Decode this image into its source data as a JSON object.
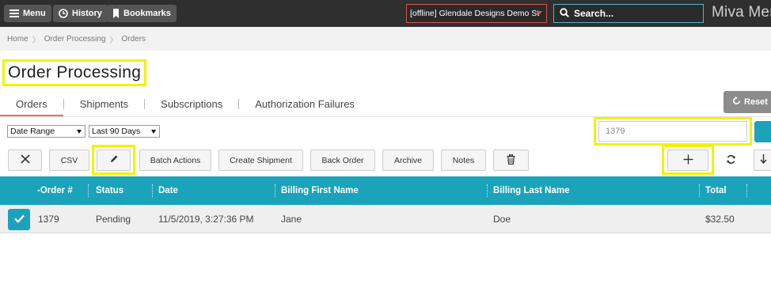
{
  "topbar": {
    "menu_label": "Menu",
    "history_label": "History",
    "bookmarks_label": "Bookmarks",
    "store_select_value": "[offline] Glendale Designs Demo St",
    "search_placeholder": "Search...",
    "brand": "Miva Mer"
  },
  "breadcrumb": [
    "Home",
    "Order Processing",
    "Orders"
  ],
  "page": {
    "title": "Order Processing"
  },
  "tabs": [
    {
      "label": "Orders",
      "active": true
    },
    {
      "label": "Shipments",
      "active": false
    },
    {
      "label": "Subscriptions",
      "active": false
    },
    {
      "label": "Authorization Failures",
      "active": false
    }
  ],
  "reset_label": "Reset",
  "filters": {
    "field_select": "Date Range",
    "range_select": "Last 90 Days",
    "search_value": "1379"
  },
  "toolbar": {
    "csv_label": "CSV",
    "batch_label": "Batch Actions",
    "create_shipment_label": "Create Shipment",
    "back_order_label": "Back Order",
    "archive_label": "Archive",
    "notes_label": "Notes"
  },
  "table": {
    "columns": [
      "-Order #",
      "Status",
      "Date",
      "Billing First Name",
      "Billing Last Name",
      "Total"
    ],
    "rows": [
      {
        "order": "1379",
        "status": "Pending",
        "date": "11/5/2019, 3:27:36 PM",
        "first": "Jane",
        "last": "Doe",
        "total": "$32.50"
      }
    ]
  },
  "colors": {
    "accent": "#1aa3ba",
    "highlight": "#f2f200",
    "active_tab": "#f06b5d",
    "topbar_bg": "#2f2f2f"
  },
  "icons": [
    "hamburger-icon",
    "clock-icon",
    "bookmark-icon",
    "search-icon",
    "refresh-icon",
    "close-icon",
    "pencil-icon",
    "trash-icon",
    "plus-icon",
    "sync-icon",
    "download-icon",
    "checkmark-icon"
  ]
}
